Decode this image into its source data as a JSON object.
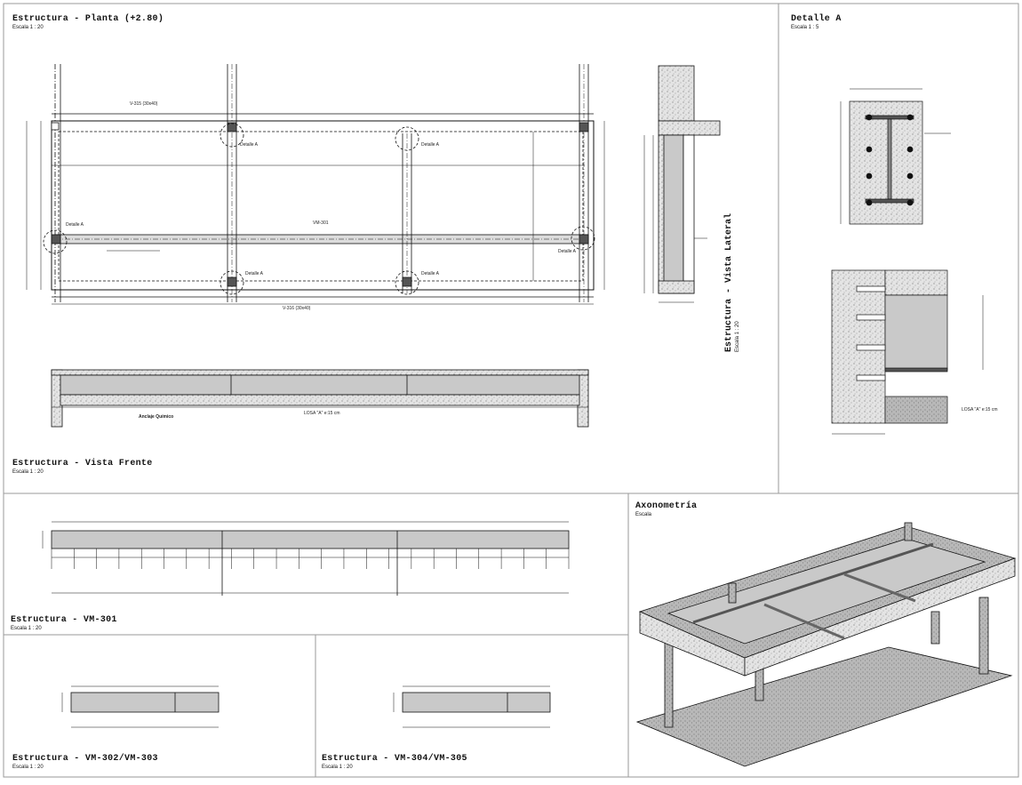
{
  "views": {
    "planta": {
      "title": "Estructura - Planta (+2.80)",
      "scale": "Escala 1 : 20"
    },
    "frente": {
      "title": "Estructura - Vista Frente",
      "scale": "Escala 1 : 20"
    },
    "lateral": {
      "title": "Estructura - Vista Lateral",
      "scale": "Escala 1 : 20"
    },
    "detalle": {
      "title": "Detalle A",
      "scale": "Escala 1 : 5"
    },
    "vm301": {
      "title": "Estructura - VM-301",
      "scale": "Escala 1 : 20"
    },
    "vm302": {
      "title": "Estructura - VM-302/VM-303",
      "scale": "Escala 1 : 20"
    },
    "vm304": {
      "title": "Estructura - VM-304/VM-305",
      "scale": "Escala 1 : 20"
    },
    "axono": {
      "title": "Axonometría",
      "scale": "Escala"
    }
  },
  "annotations": {
    "detalle_a": "Detalle A",
    "vm301": "VM-301",
    "v315": "V-315 (30x40)",
    "v316": "V-316 (30x40)",
    "anclaje": "Anclaje Químico",
    "losa": "LOSA \"A\" e:15 cm"
  },
  "colors": {
    "line": "#111111",
    "concrete": "#c9c9c9",
    "steel": "#bdbdbd",
    "border": "#9a9a9a"
  }
}
